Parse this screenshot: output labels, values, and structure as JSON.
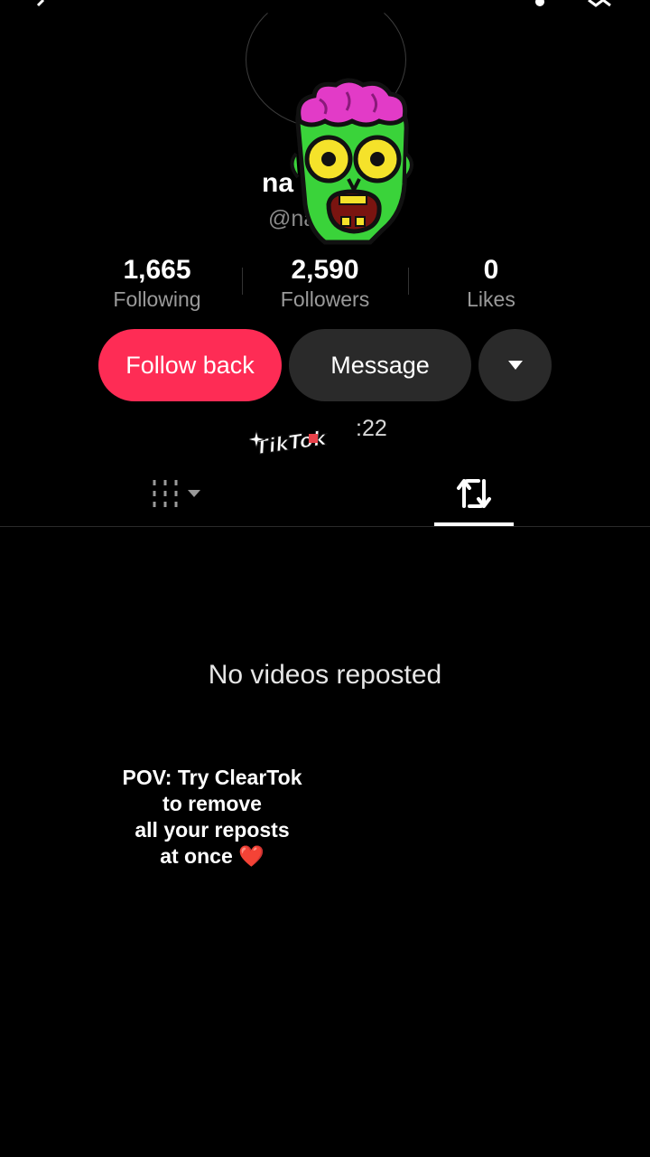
{
  "profile": {
    "username": "na",
    "handle": "@na"
  },
  "stats": [
    {
      "value": "1,665",
      "label": "Following"
    },
    {
      "value": "2,590",
      "label": "Followers"
    },
    {
      "value": "0",
      "label": "Likes"
    }
  ],
  "actions": {
    "follow_back": "Follow back",
    "message": "Message"
  },
  "joined_text": ":22",
  "sticker_text": "TikTok",
  "tabs": {
    "active": "reposts"
  },
  "empty_state": {
    "title": "No videos reposted"
  },
  "overlay": {
    "line1": "POV: Try  ClearTok",
    "line2": "to remove",
    "line3": "all your reposts",
    "line4": "at once",
    "emoji": "❤️"
  },
  "colors": {
    "follow_button": "#fe2c55",
    "secondary_button": "#2a2a2a",
    "background": "#000000"
  }
}
